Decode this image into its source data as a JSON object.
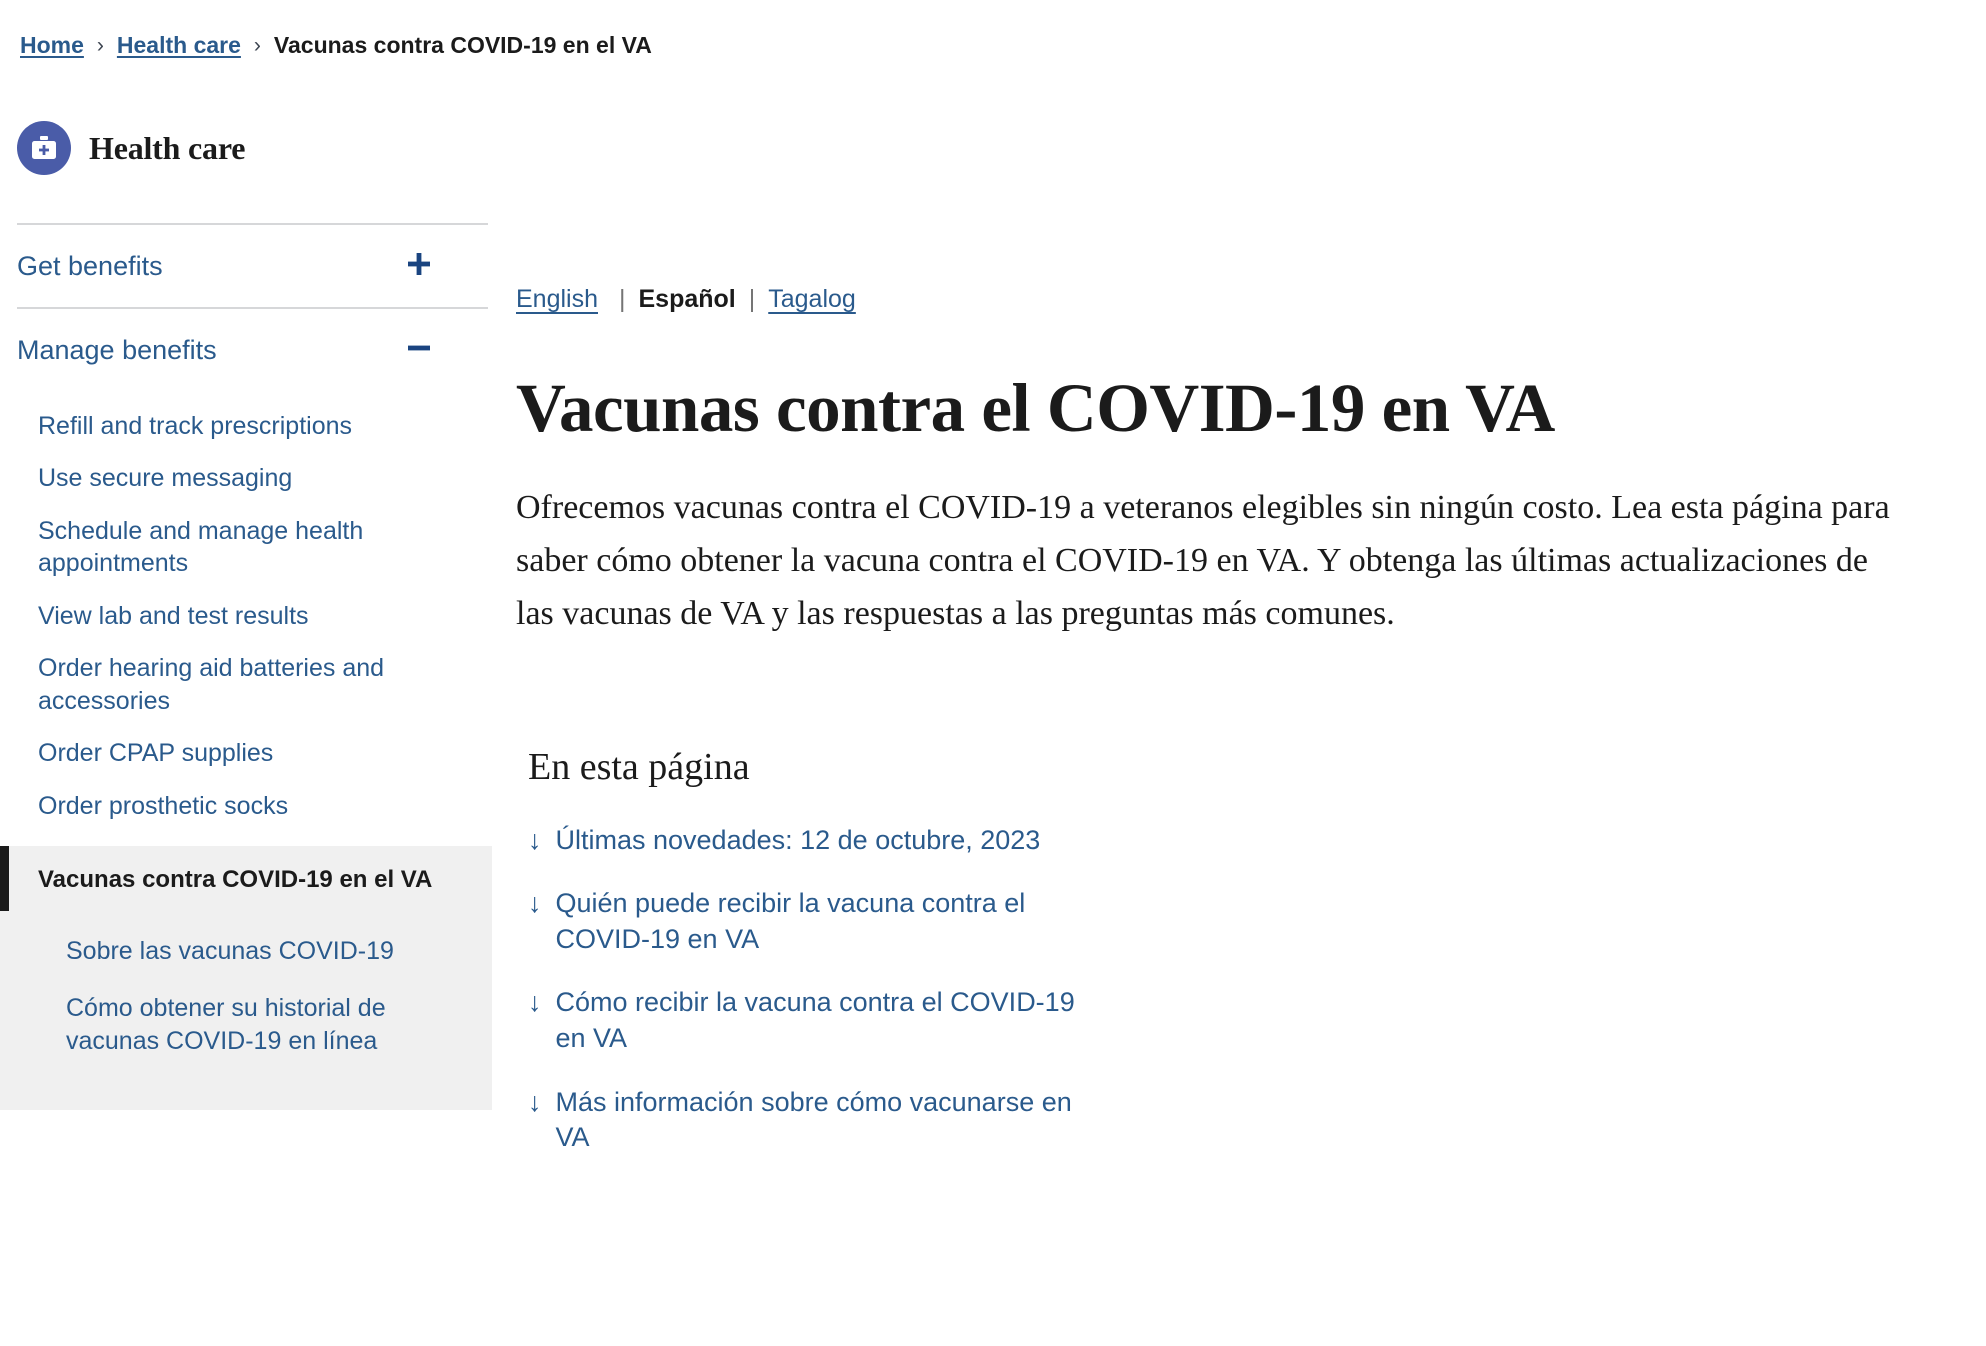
{
  "breadcrumb": {
    "items": [
      {
        "label": "Home",
        "current": false
      },
      {
        "label": "Health care",
        "current": false
      },
      {
        "label": "Vacunas contra COVID-19 en el VA",
        "current": true
      }
    ],
    "separator": "›"
  },
  "sidebar": {
    "brand": {
      "label": "Health care",
      "icon": "medical-bag-icon",
      "icon_bg": "#4a5ca8"
    },
    "accordions": [
      {
        "label": "Get benefits",
        "state": "collapsed",
        "toggle_icon": "plus-icon"
      },
      {
        "label": "Manage benefits",
        "state": "expanded",
        "toggle_icon": "minus-icon"
      }
    ],
    "manage_benefits_items": [
      "Refill and track prescriptions",
      "Use secure messaging",
      "Schedule and manage health appointments",
      "View lab and test results",
      "Order hearing aid batteries and accessories",
      "Order CPAP supplies",
      "Order prosthetic socks"
    ],
    "current_item": "Vacunas contra COVID-19 en el VA",
    "nested_items": [
      "Sobre las vacunas COVID-19",
      "Cómo obtener su historial de vacunas COVID-19 en línea"
    ]
  },
  "language_bar": {
    "english": "English",
    "spanish": "Español",
    "tagalog": "Tagalog",
    "separator": "|",
    "active": "Español"
  },
  "content": {
    "title": "Vacunas contra el COVID-19 en VA",
    "intro": "Ofrecemos vacunas contra el COVID-19 a veteranos elegibles sin ningún costo. Lea esta página para saber cómo obtener la vacuna contra el COVID-19 en  VA. Y obtenga las últimas actualizaciones de las vacunas de VA y las respuestas a las preguntas más comunes.",
    "on_this_page_heading": "En esta página",
    "arrow_glyph": "↓",
    "anchor_links": [
      "Últimas novedades: 12 de octubre, 2023",
      "Quién puede recibir la vacuna contra el COVID-19 en VA",
      "Cómo recibir la vacuna contra el COVID-19 en  VA",
      "Más información sobre cómo vacunarse en  VA"
    ]
  },
  "colors": {
    "link_blue": "#2a5a8c",
    "accent_blue": "#1a4480",
    "text_dark": "#1b1b1b",
    "divider_gray": "#d6d7d9",
    "active_panel_gray": "#f0f0f0"
  }
}
